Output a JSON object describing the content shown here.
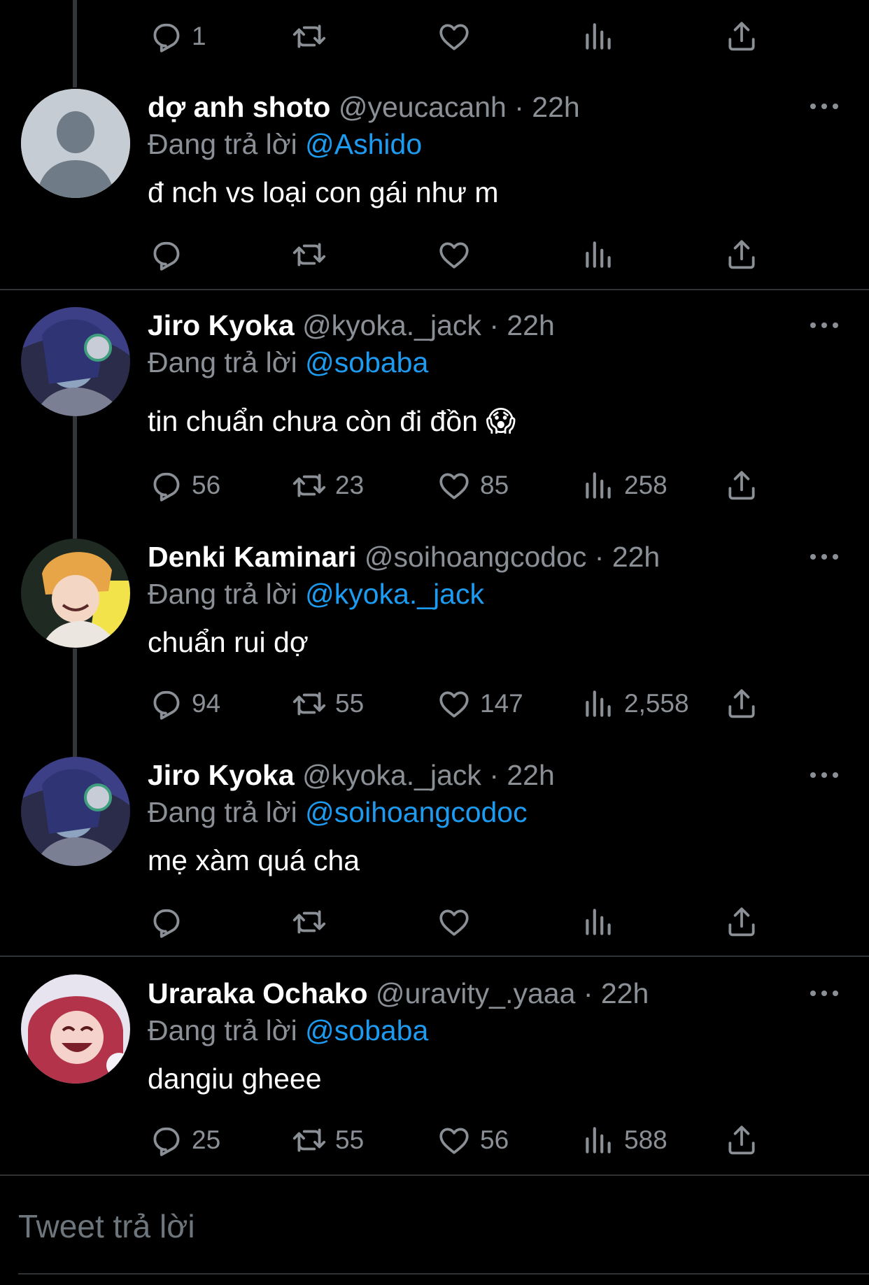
{
  "reply_prefix": "Đang trả lời",
  "top_actions": {
    "reply_count": "1",
    "retweet_count": "",
    "like_count": "",
    "views_count": ""
  },
  "tweets": [
    {
      "name": "dợ anh shoto",
      "handle": "@yeucacanh",
      "separator": "·",
      "time": "22h",
      "reply_to": "@Ashido",
      "text": "đ nch vs loại con gái như m",
      "reply_count": "",
      "retweet_count": "",
      "like_count": "",
      "views_count": ""
    },
    {
      "name": "Jiro Kyoka",
      "handle": "@kyoka._jack",
      "separator": "·",
      "time": "22h",
      "reply_to": "@sobaba",
      "text": "tin chuẩn chưa còn đi đồn 😱",
      "reply_count": "56",
      "retweet_count": "23",
      "like_count": "85",
      "views_count": "258"
    },
    {
      "name": "Denki Kaminari",
      "handle": "@soihoangcodoc",
      "separator": "·",
      "time": "22h",
      "reply_to": "@kyoka._jack",
      "text": "chuẩn rui dợ",
      "reply_count": "94",
      "retweet_count": "55",
      "like_count": "147",
      "views_count": "2,558"
    },
    {
      "name": "Jiro Kyoka",
      "handle": "@kyoka._jack",
      "separator": "·",
      "time": "22h",
      "reply_to": "@soihoangcodoc",
      "text": "mẹ xàm quá cha",
      "reply_count": "",
      "retweet_count": "",
      "like_count": "",
      "views_count": ""
    },
    {
      "name": "Uraraka Ochako",
      "handle": "@uravity_.yaaa",
      "separator": "·",
      "time": "22h",
      "reply_to": "@sobaba",
      "text": "dangiu gheee",
      "reply_count": "25",
      "retweet_count": "55",
      "like_count": "56",
      "views_count": "588"
    }
  ],
  "composer": {
    "placeholder": "Tweet trả lời"
  },
  "colors": {
    "background": "#000000",
    "text": "#e7e9ea",
    "secondary": "#8b9096",
    "mention": "#1d9bf0",
    "divider": "#2f3336"
  },
  "icons": [
    "reply-icon",
    "retweet-icon",
    "like-icon",
    "views-icon",
    "share-icon",
    "more-icon"
  ]
}
